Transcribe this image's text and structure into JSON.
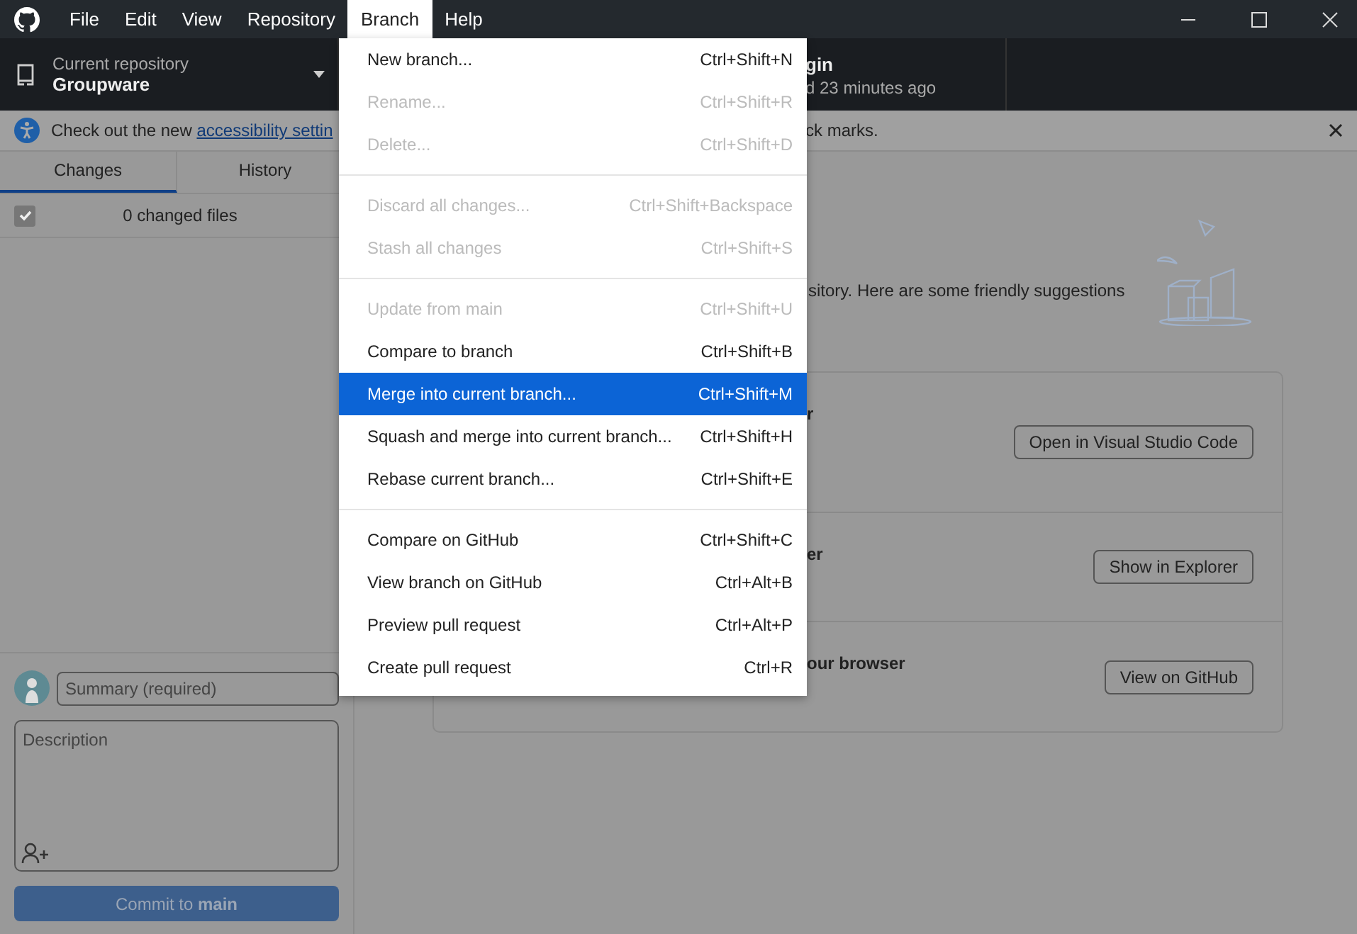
{
  "menubar": [
    {
      "label": "File",
      "selected": false
    },
    {
      "label": "Edit",
      "selected": false
    },
    {
      "label": "View",
      "selected": false
    },
    {
      "label": "Repository",
      "selected": false
    },
    {
      "label": "Branch",
      "selected": true
    },
    {
      "label": "Help",
      "selected": false
    }
  ],
  "toolbar": {
    "repository_label": "Current repository",
    "repository_name": "Groupware",
    "fetch_title": "gin",
    "fetch_subtitle": "d 23 minutes ago"
  },
  "banner": {
    "text": "Check out the new ",
    "link": "accessibility settin",
    "tail": "ck marks."
  },
  "tabs": [
    {
      "label": "Changes",
      "selected": true
    },
    {
      "label": "History",
      "selected": false
    }
  ],
  "changes": {
    "all_checked": true,
    "count": "0 changed files"
  },
  "commit": {
    "summary_placeholder": "Summary (required)",
    "description_placeholder": "Description",
    "button": "Commit to **main**"
  },
  "main": {
    "intro": "sitory. Here are some friendly suggestions",
    "cards": [
      {
        "title": "r",
        "button": "Open in Visual Studio Code"
      },
      {
        "title": "er",
        "button": "Show in Explorer"
      },
      {
        "title": "our browser",
        "button": "View on GitHub"
      }
    ]
  },
  "menu": {
    "groups": [
      [
        {
          "label": "New branch...",
          "shortcut": "Ctrl+Shift+N",
          "disabled": false,
          "selected": false
        },
        {
          "label": "Rename...",
          "shortcut": "Ctrl+Shift+R",
          "disabled": true,
          "selected": false
        },
        {
          "label": "Delete...",
          "shortcut": "Ctrl+Shift+D",
          "disabled": true,
          "selected": false
        }
      ],
      [
        {
          "label": "Discard all changes...",
          "shortcut": "Ctrl+Shift+Backspace",
          "disabled": true,
          "selected": false
        },
        {
          "label": "Stash all changes",
          "shortcut": "Ctrl+Shift+S",
          "disabled": true,
          "selected": false
        }
      ],
      [
        {
          "label": "Update from main",
          "shortcut": "Ctrl+Shift+U",
          "disabled": true,
          "selected": false
        },
        {
          "label": "Compare to branch",
          "shortcut": "Ctrl+Shift+B",
          "disabled": false,
          "selected": false
        },
        {
          "label": "Merge into current branch...",
          "shortcut": "Ctrl+Shift+M",
          "disabled": false,
          "selected": true
        },
        {
          "label": "Squash and merge into current branch...",
          "shortcut": "Ctrl+Shift+H",
          "disabled": false,
          "selected": false
        },
        {
          "label": "Rebase current branch...",
          "shortcut": "Ctrl+Shift+E",
          "disabled": false,
          "selected": false
        }
      ],
      [
        {
          "label": "Compare on GitHub",
          "shortcut": "Ctrl+Shift+C",
          "disabled": false,
          "selected": false
        },
        {
          "label": "View branch on GitHub",
          "shortcut": "Ctrl+Alt+B",
          "disabled": false,
          "selected": false
        },
        {
          "label": "Preview pull request",
          "shortcut": "Ctrl+Alt+P",
          "disabled": false,
          "selected": false
        },
        {
          "label": "Create pull request",
          "shortcut": "Ctrl+R",
          "disabled": false,
          "selected": false
        }
      ]
    ]
  }
}
